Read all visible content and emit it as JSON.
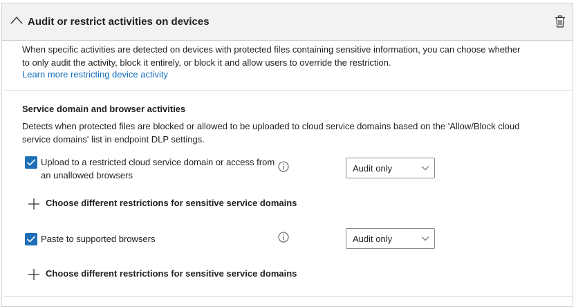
{
  "header": {
    "title": "Audit or restrict activities on devices"
  },
  "intro": {
    "text": "When specific activities are detected on devices with protected files containing sensitive information, you can choose whether to only audit the activity, block it entirely, or block it and allow users to override the restriction.",
    "link": "Learn more restricting device activity"
  },
  "section": {
    "title": "Service domain and browser activities",
    "description": "Detects when protected files are blocked or allowed to be uploaded to cloud service domains based on the 'Allow/Block cloud service domains' list in endpoint DLP settings."
  },
  "rows": [
    {
      "label": "Upload to a restricted cloud service domain or access from an unallowed browsers",
      "checked": true,
      "dropdown_value": "Audit only",
      "add_link": "Choose different restrictions for sensitive service domains"
    },
    {
      "label": "Paste to supported browsers",
      "checked": true,
      "dropdown_value": "Audit only",
      "add_link": "Choose different restrictions for sensitive service domains"
    }
  ],
  "colors": {
    "accent": "#1e6fb5",
    "link": "#0f6cbd",
    "header_bg": "#f3f2f1"
  }
}
